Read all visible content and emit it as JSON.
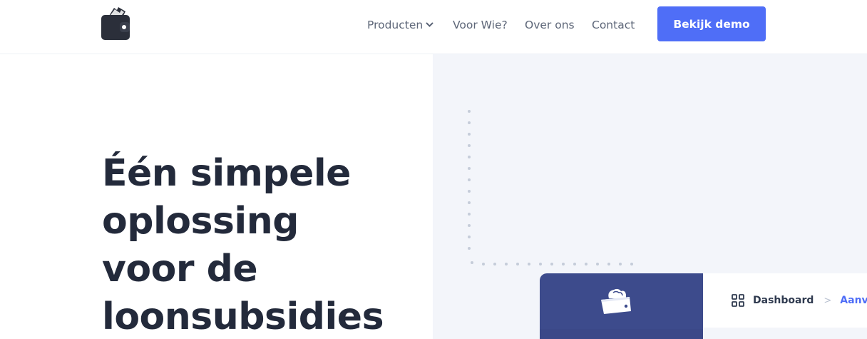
{
  "nav": {
    "logo_icon": "wallet-icon",
    "links": [
      {
        "label": "Producten",
        "icon": "chevron-down-icon"
      },
      {
        "label": "Voor Wie?"
      },
      {
        "label": "Over ons"
      },
      {
        "label": "Contact"
      }
    ],
    "cta_label": "Bekijk demo"
  },
  "hero": {
    "title_lines": [
      "Één simpele",
      "oplossing",
      "voor de",
      "loonsubsidies"
    ]
  },
  "app_preview": {
    "logo_icon": "wallet-icon",
    "breadcrumb": {
      "icon": "grid-icon",
      "items": [
        "Dashboard",
        "Aanvra"
      ],
      "separator": ">"
    }
  },
  "colors": {
    "accent": "#4f6ef7",
    "text_dark": "#232a3b",
    "nav_text": "#5d6678",
    "hero_panel_bg": "#f3f5fa",
    "app_sidebar": "#3d4b8c"
  }
}
